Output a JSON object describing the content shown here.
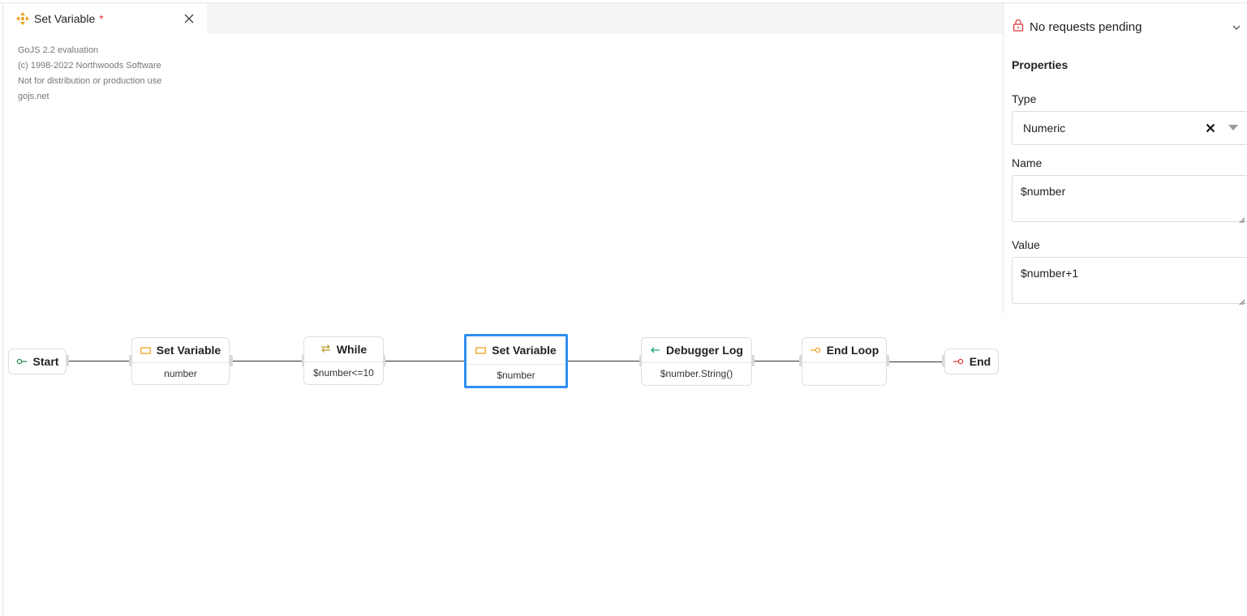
{
  "tab": {
    "title": "Set Variable",
    "dirty_marker": "*",
    "icon": "move-arrows-icon",
    "close_icon": "close-icon"
  },
  "watermark": {
    "lines": [
      "GoJS 2.2 evaluation",
      "(c) 1998-2022 Northwoods Software",
      "Not for distribution or production use",
      "gojs.net"
    ]
  },
  "panel": {
    "requests": {
      "label": "No requests pending",
      "icon": "lock-icon",
      "chevron": "chevron-down-icon"
    },
    "properties_title": "Properties",
    "type_label": "Type",
    "type_value": "Numeric",
    "name_label": "Name",
    "name_value": "$number",
    "value_label": "Value",
    "value_value": "$number+1"
  },
  "colors": {
    "accent_orange": "#f0a020",
    "start_green": "#2e8b57",
    "end_red": "#e03a3a",
    "log_green": "#1aa36f",
    "selected_blue": "#2f8ff0",
    "dirty_red": "#e03a3a"
  },
  "flow": {
    "start": {
      "label": "Start",
      "icon": "start-port-icon"
    },
    "set_variable_1": {
      "title": "Set Variable",
      "subtitle": "number",
      "icon": "rectangle-icon"
    },
    "while": {
      "title": "While",
      "subtitle": "$number<=10",
      "icon": "loop-arrows-icon"
    },
    "set_variable_2": {
      "title": "Set Variable",
      "subtitle": "$number",
      "icon": "rectangle-icon",
      "selected": true
    },
    "debugger_log": {
      "title": "Debugger Log",
      "subtitle": "$number.String()",
      "icon": "arrow-left-icon"
    },
    "end_loop": {
      "title": "End Loop",
      "subtitle": "",
      "icon": "end-loop-icon"
    },
    "end": {
      "label": "End",
      "icon": "end-port-icon"
    }
  }
}
